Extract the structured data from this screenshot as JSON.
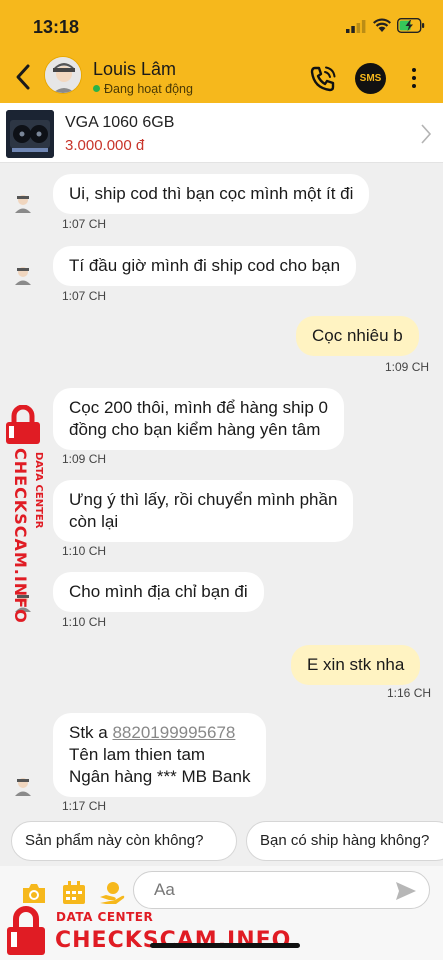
{
  "status_bar": {
    "time": "13:18"
  },
  "header": {
    "contact_name": "Louis Lâm",
    "presence": "Đang hoạt động",
    "sms_label": "SMS"
  },
  "product": {
    "title": "VGA 1060 6GB",
    "price": "3.000.000 đ"
  },
  "messages": [
    {
      "dir": "in",
      "text": "Ui, ship cod thì bạn cọc mình một ít đi",
      "time": "1:07 CH"
    },
    {
      "dir": "in",
      "text": "Tí đầu giờ mình đi ship cod cho bạn",
      "time": "1:07 CH"
    },
    {
      "dir": "out",
      "text": "Cọc nhiêu b",
      "time": "1:09 CH"
    },
    {
      "dir": "in",
      "lines": [
        "Cọc 200 thôi, mình để hàng ship 0",
        "đồng cho bạn kiểm hàng yên tâm"
      ],
      "time": "1:09 CH"
    },
    {
      "dir": "in",
      "lines": [
        "Ưng ý thì lấy, rồi chuyển mình phần",
        "còn lại"
      ],
      "time": "1:10 CH"
    },
    {
      "dir": "in",
      "text": "Cho mình địa chỉ bạn đi",
      "time": "1:10 CH"
    },
    {
      "dir": "out",
      "text": "E xin stk nha",
      "time": "1:16 CH"
    },
    {
      "dir": "in",
      "line1_prefix": "Stk a ",
      "account": "8820199995678",
      "line2": "Tên lam thien tam",
      "line3": "Ngân hàng *** MB Bank",
      "time": "1:17 CH"
    }
  ],
  "quick_replies": [
    "Sản phẩm này còn không?",
    "Bạn có ship hàng không?"
  ],
  "composer": {
    "placeholder": "Aa"
  },
  "watermark": {
    "small": "DATA CENTER",
    "big": "CHECKSCAM.INFO"
  },
  "colors": {
    "header": "#f6b81c",
    "outgoing_bubble": "#fff3c2",
    "price": "#c8352b",
    "watermark": "#e01c24"
  }
}
